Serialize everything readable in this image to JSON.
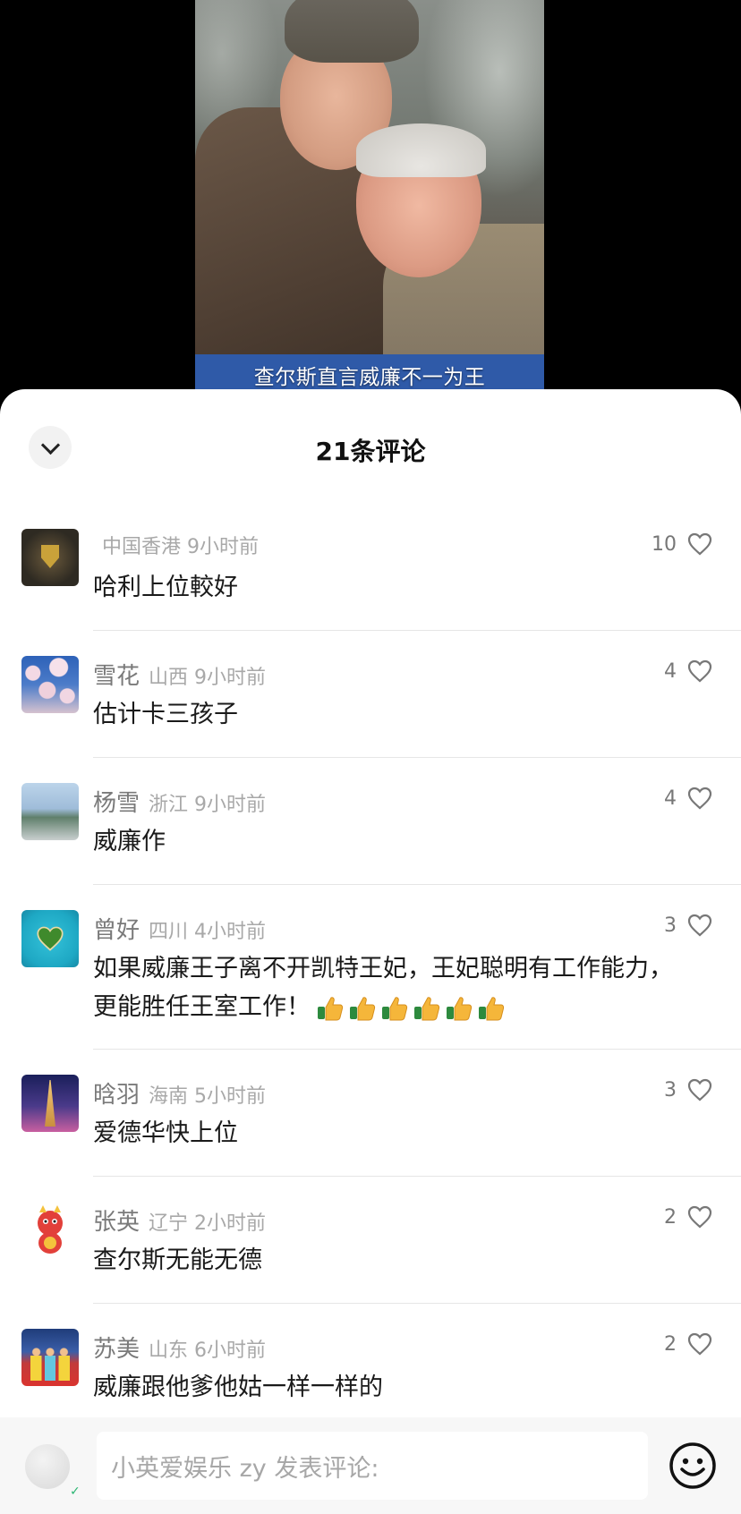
{
  "video": {
    "subtitle": "查尔斯直言威廉不一为王"
  },
  "header": {
    "title": "21条评论",
    "collapse_icon": "chevron-down-icon"
  },
  "comments": [
    {
      "name": "",
      "location": "中国香港 9小时前",
      "text": "哈利上位較好",
      "likes": "10"
    },
    {
      "name": "雪花",
      "location": "山西 9小时前",
      "text": "估计卡三孩子",
      "likes": "4"
    },
    {
      "name": "杨雪",
      "location": "浙江 9小时前",
      "text": "威廉作",
      "likes": "4"
    },
    {
      "name": "曾好",
      "location": "四川 4小时前",
      "text": "如果威廉王子离不开凯特王妃，王妃聪明有工作能力，更能胜任王室工作！",
      "emoji": "thumbs-up-icon ×6",
      "likes": "3"
    },
    {
      "name": "晗羽",
      "location": "海南 5小时前",
      "text": "爱德华快上位",
      "likes": "3"
    },
    {
      "name": "张英",
      "location": "辽宁 2小时前",
      "text": "查尔斯无能无德",
      "likes": "2"
    },
    {
      "name": "苏美",
      "location": "山东 6小时前",
      "text": "威廉跟他爹他姑一样一样的",
      "likes": "2"
    }
  ],
  "composer": {
    "placeholder": "小英爱娱乐 zy 发表评论:",
    "emoji_icon": "smile-icon"
  },
  "colors": {
    "subtitle_band": "#2f5aa8",
    "divider": "#e6e6e6",
    "meta_gray": "#a8a8a8",
    "name_gray": "#7a7a7a"
  }
}
